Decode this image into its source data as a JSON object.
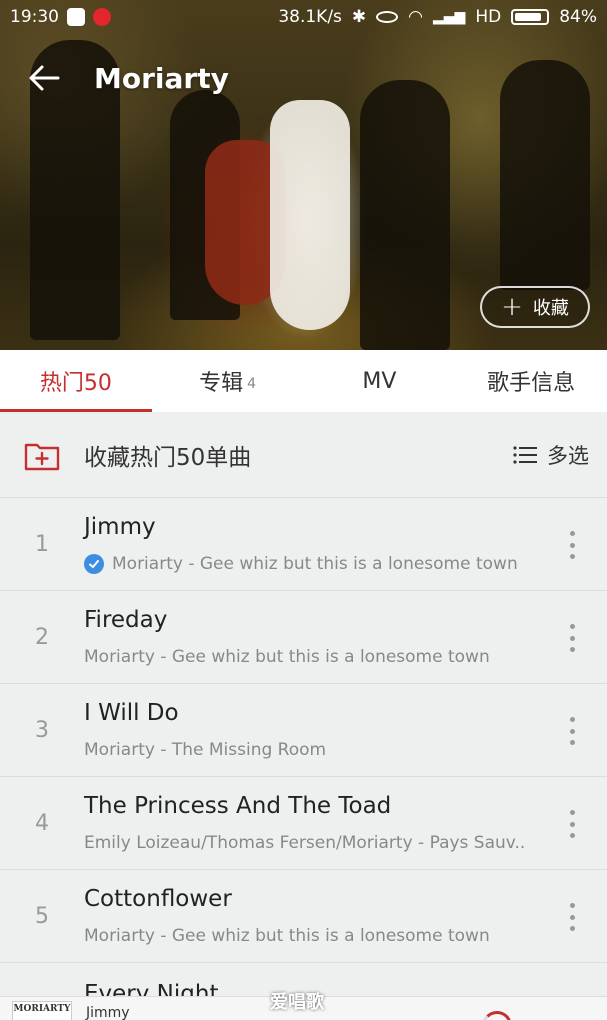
{
  "status_bar": {
    "time": "19:30",
    "network_speed": "38.1K/s",
    "network_type": "HD",
    "battery": "84%"
  },
  "header": {
    "title": "Moriarty",
    "collect_label": "收藏"
  },
  "tabs": [
    {
      "label": "热门50",
      "count": ""
    },
    {
      "label": "专辑",
      "count": "4"
    },
    {
      "label": "MV",
      "count": ""
    },
    {
      "label": "歌手信息",
      "count": ""
    }
  ],
  "collect_row": {
    "label": "收藏热门50单曲",
    "multi_select_label": "多选"
  },
  "songs": [
    {
      "index": "1",
      "title": "Jimmy",
      "meta": "Moriarty - Gee whiz but this is a lonesome town",
      "verified": true
    },
    {
      "index": "2",
      "title": "Fireday",
      "meta": "Moriarty - Gee whiz but this is a lonesome town",
      "verified": false
    },
    {
      "index": "3",
      "title": "I Will Do",
      "meta": "Moriarty - The Missing Room",
      "verified": false
    },
    {
      "index": "4",
      "title": "The Princess And The Toad",
      "meta": "Emily Loizeau/Thomas Fersen/Moriarty - Pays Sauv...",
      "verified": false
    },
    {
      "index": "5",
      "title": "Cottonflower",
      "meta": "Moriarty - Gee whiz but this is a lonesome town",
      "verified": false
    },
    {
      "index": "",
      "title": "Every Night",
      "meta": "",
      "verified": false
    }
  ],
  "player": {
    "cover_text": "MORIARTY",
    "now_playing": "Jimmy"
  },
  "watermark": "爱唱歌",
  "colors": {
    "accent": "#c62f2f",
    "verified": "#3d8ee0"
  }
}
